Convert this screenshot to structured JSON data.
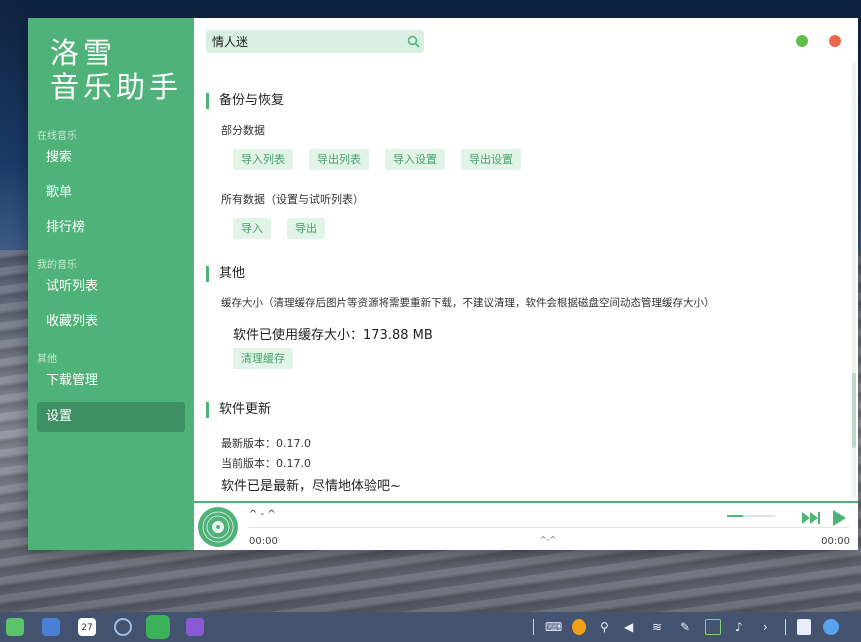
{
  "app": {
    "logo_line1": "洛雪",
    "logo_line2": "音乐助手"
  },
  "sidebar": {
    "group_online": "在线音乐",
    "search": "搜索",
    "playlists": "歌单",
    "charts": "排行榜",
    "group_mine": "我的音乐",
    "trial_list": "试听列表",
    "favorites": "收藏列表",
    "group_other": "其他",
    "downloads": "下载管理",
    "settings": "设置"
  },
  "header": {
    "search_value": "情人迷"
  },
  "backup": {
    "title": "备份与恢复",
    "partial_label": "部分数据",
    "import_list": "导入列表",
    "export_list": "导出列表",
    "import_settings": "导入设置",
    "export_settings": "导出设置",
    "all_label": "所有数据（设置与试听列表）",
    "import_all": "导入",
    "export_all": "导出"
  },
  "other": {
    "title": "其他",
    "cache_label": "缓存大小（清理缓存后图片等资源将需要重新下载，不建议清理，软件会根据磁盘空间动态管理缓存大小）",
    "cache_used": "软件已使用缓存大小：173.88 MB",
    "clear_cache": "清理缓存"
  },
  "update": {
    "title": "软件更新",
    "latest": "最新版本：0.17.0",
    "current": "当前版本：0.17.0",
    "status": "软件已是最新，尽情地体验吧~"
  },
  "player": {
    "title": "^ - ^",
    "mid_text": "^-^",
    "time_elapsed": "00:00",
    "time_total": "00:00",
    "volume": 0.33
  },
  "taskbar": {
    "calendar_day": "27"
  },
  "colors": {
    "accent": "#4fb278",
    "accent_dark": "#3e9163",
    "btn_bg": "#e2f3e8",
    "minimize_dot": "#5cbd4a",
    "close_dot": "#e86a4d"
  }
}
